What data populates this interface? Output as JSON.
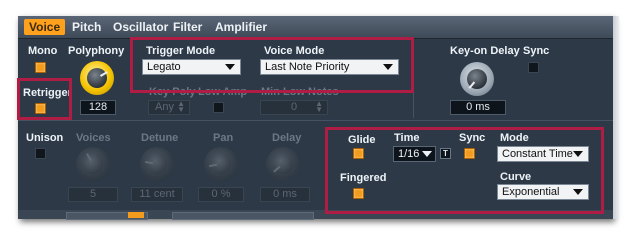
{
  "tabs": [
    {
      "label": "Voice"
    },
    {
      "label": "Pitch"
    },
    {
      "label": "Oscillator"
    },
    {
      "label": "Filter"
    },
    {
      "label": "Amplifier"
    }
  ],
  "voice": {
    "mono": "Mono",
    "polyphony": "Polyphony",
    "polyphony_value": "128",
    "retrigger": "Retrigger",
    "trigger_mode_label": "Trigger Mode",
    "trigger_mode_value": "Legato",
    "voice_mode_label": "Voice Mode",
    "voice_mode_value": "Last Note Priority",
    "key_poly_label": "Key Poly",
    "key_poly_value": "Any",
    "low_amp_label": "Low Amp",
    "min_low_notes_label": "Min Low Notes",
    "min_low_notes_value": "0",
    "key_on_delay_label": "Key-on Delay",
    "key_on_delay_value": "0 ms",
    "sync_label": "Sync"
  },
  "unison": {
    "label": "Unison",
    "voices_label": "Voices",
    "voices_value": "5",
    "detune_label": "Detune",
    "detune_value": "11 cent",
    "pan_label": "Pan",
    "pan_value": "0 %",
    "delay_label": "Delay",
    "delay_value": "0 ms"
  },
  "glide": {
    "glide_label": "Glide",
    "time_label": "Time",
    "time_value": "1/16",
    "time_t": "T",
    "sync_label": "Sync",
    "mode_label": "Mode",
    "mode_value": "Constant Time",
    "fingered_label": "Fingered",
    "curve_label": "Curve",
    "curve_value": "Exponential"
  },
  "colors": {
    "accent": "#f29b1d",
    "highlight": "#b01d44",
    "panel": "#2d3947"
  }
}
